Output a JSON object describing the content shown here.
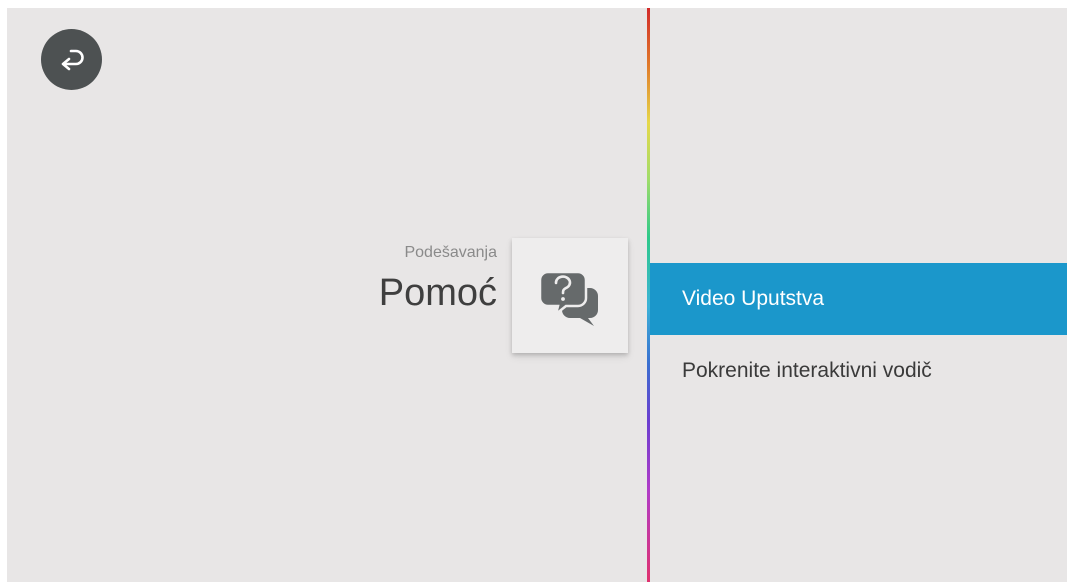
{
  "header": {
    "back_icon": "back-arrow-icon"
  },
  "sidebar": {
    "breadcrumb": "Podešavanja",
    "title": "Pomoć",
    "category_icon": "help-chat-icon"
  },
  "menu": {
    "items": [
      {
        "label": "Video Uputstva",
        "selected": true
      },
      {
        "label": "Pokrenite interaktivni vodič",
        "selected": false
      }
    ]
  },
  "colors": {
    "background": "#e8e6e6",
    "selected": "#1b97cb",
    "back_button": "#4d5152",
    "icon": "#666a6b"
  }
}
